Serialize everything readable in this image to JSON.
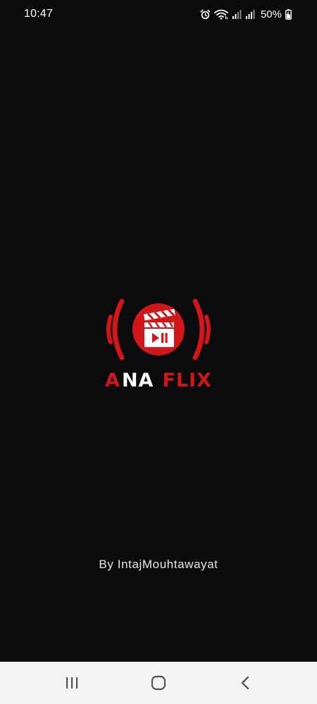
{
  "status_bar": {
    "time": "10:47",
    "battery": "50%",
    "icons": [
      "alarm-icon",
      "wifi-icon",
      "signal-icon",
      "signal-icon",
      "battery-icon"
    ]
  },
  "logo": {
    "word_a": "A",
    "word_na": "NA",
    "word_flix": "FLIX",
    "colors": {
      "brand_red": "#d0181b",
      "white": "#ffffff"
    }
  },
  "byline": "By IntajMouhtawayat",
  "nav_bar": {
    "buttons": [
      "recent-apps-icon",
      "home-icon",
      "back-icon"
    ]
  },
  "colors": {
    "background": "#0b0a0c",
    "nav_background": "#f4f4f4",
    "nav_icon": "#555555"
  }
}
